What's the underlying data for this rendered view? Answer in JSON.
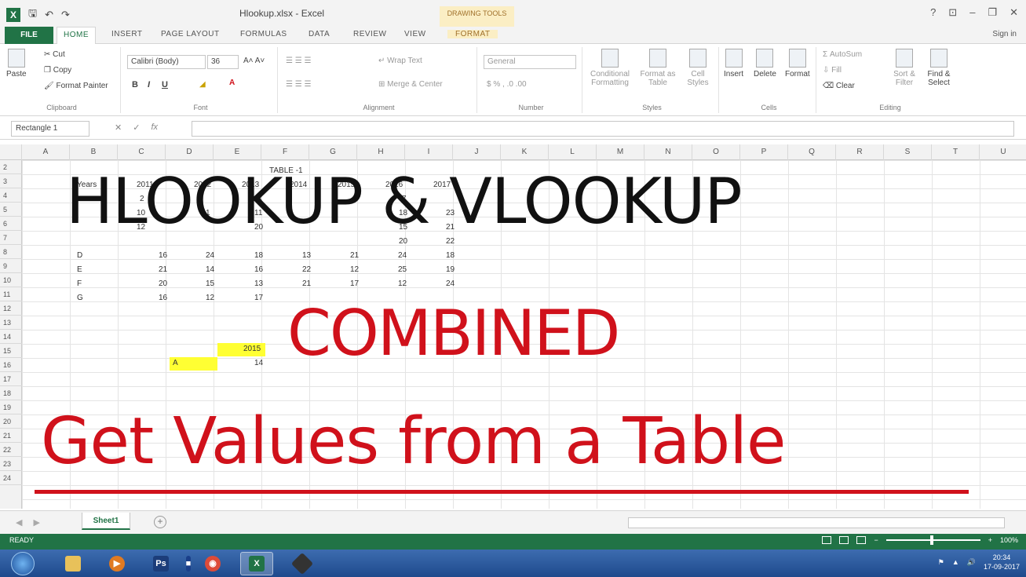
{
  "titlebar": {
    "title": "Hlookup.xlsx - Excel",
    "drawing_tools": "DRAWING TOOLS",
    "help": "?",
    "restore_ribbon": "⊡",
    "minimize": "–",
    "maximize": "❐",
    "close": "✕"
  },
  "tabs": {
    "file": "FILE",
    "home": "HOME",
    "insert": "INSERT",
    "page_layout": "PAGE LAYOUT",
    "formulas": "FORMULAS",
    "data": "DATA",
    "review": "REVIEW",
    "view": "VIEW",
    "format": "FORMAT",
    "sign_in": "Sign in"
  },
  "ribbon": {
    "clipboard": {
      "paste": "Paste",
      "cut": "Cut",
      "copy": "Copy",
      "format_painter": "Format Painter",
      "label": "Clipboard"
    },
    "font": {
      "name": "Calibri (Body)",
      "size": "36",
      "label": "Font",
      "bold": "B",
      "italic": "I",
      "underline": "U"
    },
    "alignment": {
      "wrap_text": "Wrap Text",
      "merge_center": "Merge & Center",
      "label": "Alignment"
    },
    "number": {
      "format": "General",
      "label": "Number"
    },
    "styles": {
      "conditional": "Conditional Formatting",
      "format_as_table": "Format as Table",
      "cell_styles": "Cell Styles",
      "label": "Styles"
    },
    "cells": {
      "insert": "Insert",
      "delete": "Delete",
      "format": "Format",
      "label": "Cells"
    },
    "editing": {
      "autosum": "AutoSum",
      "fill": "Fill",
      "clear": "Clear",
      "sort_filter": "Sort & Filter",
      "find_select": "Find & Select",
      "label": "Editing"
    }
  },
  "formula_bar": {
    "name_box": "Rectangle 1",
    "fx": "fx",
    "cancel": "✕",
    "enter": "✓",
    "value": ""
  },
  "columns": [
    "A",
    "B",
    "C",
    "D",
    "E",
    "F",
    "G",
    "H",
    "I",
    "J",
    "K",
    "L",
    "M",
    "N",
    "O",
    "P",
    "Q",
    "R",
    "S",
    "T",
    "U"
  ],
  "rows": [
    "2",
    "3",
    "4",
    "5",
    "6",
    "7",
    "8",
    "9",
    "10",
    "11",
    "12",
    "13",
    "14",
    "15",
    "16",
    "17",
    "18",
    "19",
    "20",
    "21",
    "22",
    "23",
    "24"
  ],
  "sheet": {
    "table_title": "TABLE -1",
    "years_label": "Years",
    "years": [
      "2011",
      "2012",
      "2013",
      "2014",
      "2015",
      "2016",
      "2017"
    ],
    "rows": [
      {
        "key": "D",
        "values": [
          "16",
          "24",
          "18",
          "13",
          "21",
          "24",
          "18"
        ]
      },
      {
        "key": "E",
        "values": [
          "21",
          "14",
          "16",
          "22",
          "12",
          "25",
          "19"
        ]
      },
      {
        "key": "F",
        "values": [
          "20",
          "15",
          "13",
          "21",
          "17",
          "12",
          "24"
        ]
      },
      {
        "key": "G",
        "values": [
          "16",
          "12",
          "17",
          "",
          "",
          "",
          ""
        ]
      }
    ],
    "partial": {
      "r4c": "2",
      "r4d": "4",
      "r4g": "7",
      "r5c": "10",
      "r5d": "1",
      "r5e": "11",
      "r5h": "18",
      "r5i": "23",
      "r6c": "12",
      "r6e": "20",
      "r6h": "15",
      "r6i": "21",
      "r7h": "20",
      "r7i": "22"
    },
    "lookup_year": "2015",
    "lookup_key": "A",
    "lookup_result": "14"
  },
  "overlay": {
    "line1": "HLOOKUP & VLOOKUP",
    "line2": "COMBINED",
    "line3": "Get Values from a Table"
  },
  "sheet_tabs": {
    "sheet1": "Sheet1",
    "add": "+",
    "nav_prev": "◀",
    "nav_next": "▶"
  },
  "status": {
    "ready": "READY",
    "zoom": "100%",
    "zoom_minus": "−",
    "zoom_plus": "+"
  },
  "taskbar": {
    "apps": [
      "explorer",
      "media",
      "photoshop",
      "dropbox",
      "chrome",
      "excel",
      "game"
    ],
    "time": "20:34",
    "date": "17-09-2017"
  },
  "colors": {
    "excel_green": "#217346",
    "overlay_red": "#d0111b",
    "highlight_yellow": "#ffff33"
  }
}
